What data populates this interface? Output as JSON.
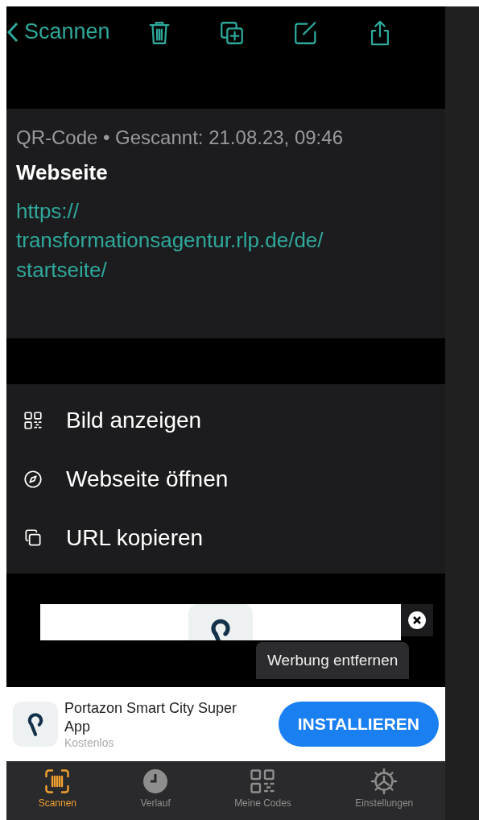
{
  "nav": {
    "back": "Scannen"
  },
  "info": {
    "meta": "QR-Code • Gescannt: 21.08.23, 09:46",
    "type": "Webseite",
    "url": "https://\ntransformationsagentur.rlp.de/de/\nstartseite/"
  },
  "actions": [
    {
      "kind": "qr",
      "label": "Bild anzeigen"
    },
    {
      "kind": "compass",
      "label": "Webseite öffnen"
    },
    {
      "kind": "copy",
      "label": "URL kopieren"
    }
  ],
  "ad": {
    "remove": "Werbung entfernen",
    "app": "Portazon Smart City Super App",
    "price": "Kostenlos",
    "cta": "INSTALLIEREN"
  },
  "tabs": [
    {
      "kind": "scan",
      "label": "Scannen",
      "selected": true
    },
    {
      "kind": "history",
      "label": "Verlauf",
      "selected": false
    },
    {
      "kind": "qr",
      "label": "Meine Codes",
      "selected": false
    },
    {
      "kind": "settings",
      "label": "Einstellungen",
      "selected": false
    }
  ]
}
